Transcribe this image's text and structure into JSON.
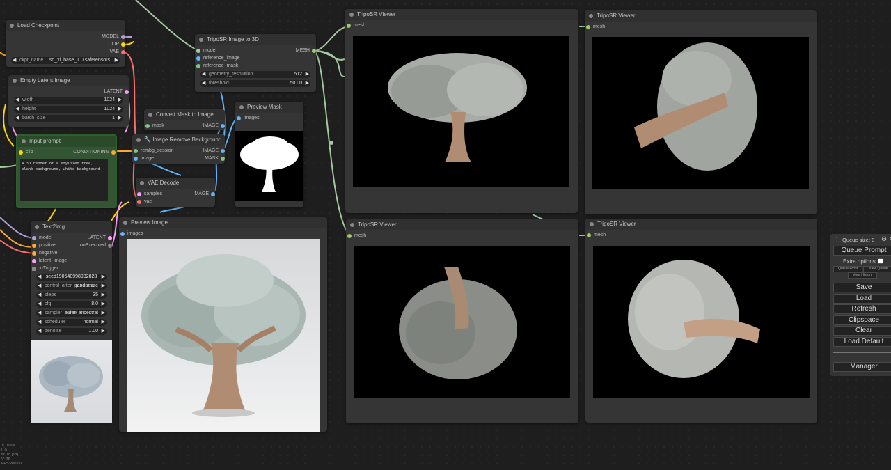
{
  "nodes": {
    "load_checkpoint": {
      "title": "Load Checkpoint",
      "outputs": [
        "MODEL",
        "CLIP",
        "VAE"
      ],
      "ckpt_label": "ckpt_name",
      "ckpt_value": "sd_xl_base_1.0.safetensors"
    },
    "empty_latent": {
      "title": "Empty Latent Image",
      "output": "LATENT",
      "width_label": "width",
      "width_value": "1024",
      "height_label": "height",
      "height_value": "1024",
      "batch_label": "batch_size",
      "batch_value": "1"
    },
    "input_prompt": {
      "title": "Input prompt",
      "input": "clip",
      "output": "CONDITIONING",
      "text": "A 3D render of a stylized tree, blank background, white background"
    },
    "text2img": {
      "title": "Text2img",
      "inputs": [
        "model",
        "positive",
        "negative",
        "latent_image"
      ],
      "outputs": [
        "LATENT",
        "onExecuted"
      ],
      "trigger": "onTrigger",
      "widgets": [
        {
          "label": "seed",
          "value": "190540998932828"
        },
        {
          "label": "control_after_generate",
          "value": "randomize"
        },
        {
          "label": "steps",
          "value": "35"
        },
        {
          "label": "cfg",
          "value": "8.0"
        },
        {
          "label": "sampler_name",
          "value": "euler_ancestral"
        },
        {
          "label": "scheduler",
          "value": "normal"
        },
        {
          "label": "denoise",
          "value": "1.00"
        }
      ]
    },
    "triposr_image_to_3d": {
      "title": "TripoSR Image to 3D",
      "inputs": [
        "model",
        "reference_image",
        "reference_mask"
      ],
      "output": "MESH",
      "res_label": "geometry_resolution",
      "res_value": "512",
      "thr_label": "threshold",
      "thr_value": "50.00"
    },
    "convert_mask": {
      "title": "Convert Mask to Image",
      "input": "mask",
      "output": "IMAGE"
    },
    "remove_bg": {
      "title": "Image Remove Background",
      "inputs": [
        "rembg_session",
        "image"
      ],
      "outputs": [
        "IMAGE",
        "MASK"
      ]
    },
    "vae_decode": {
      "title": "VAE Decode",
      "inputs": [
        "samples",
        "vae"
      ],
      "output": "IMAGE"
    },
    "preview_mask": {
      "title": "Preview Mask",
      "input": "images"
    },
    "preview_image": {
      "title": "Preview Image",
      "input": "images"
    },
    "viewers": [
      {
        "title": "TripoSR Viewer",
        "input": "mesh"
      },
      {
        "title": "TripoSR Viewer",
        "input": "mesh"
      },
      {
        "title": "TripoSR Viewer",
        "input": "mesh"
      },
      {
        "title": "TripoSR Viewer",
        "input": "mesh"
      }
    ]
  },
  "queue_panel": {
    "queue_size": "Queue size: 0",
    "queue_prompt": "Queue Prompt",
    "extra_options": "Extra options",
    "queue_front": "Queue Front",
    "view_queue": "View Queue",
    "view_history": "View History",
    "save": "Save",
    "load": "Load",
    "refresh": "Refresh",
    "clipspace": "Clipspace",
    "clear": "Clear",
    "load_default": "Load Default",
    "manager": "Manager"
  },
  "stats": [
    "T: 0.00s",
    "I: 0",
    "N: 18 [18]",
    "V: 36",
    "FPS:200.00"
  ],
  "colors": {
    "model": "#b39ddb",
    "clip": "#ffd500",
    "vae": "#ff6e6e",
    "latent": "#ff9cf9",
    "conditioning": "#ffa931",
    "image": "#64b5f6",
    "mask": "#81c784",
    "mesh": "#9ccc65"
  }
}
